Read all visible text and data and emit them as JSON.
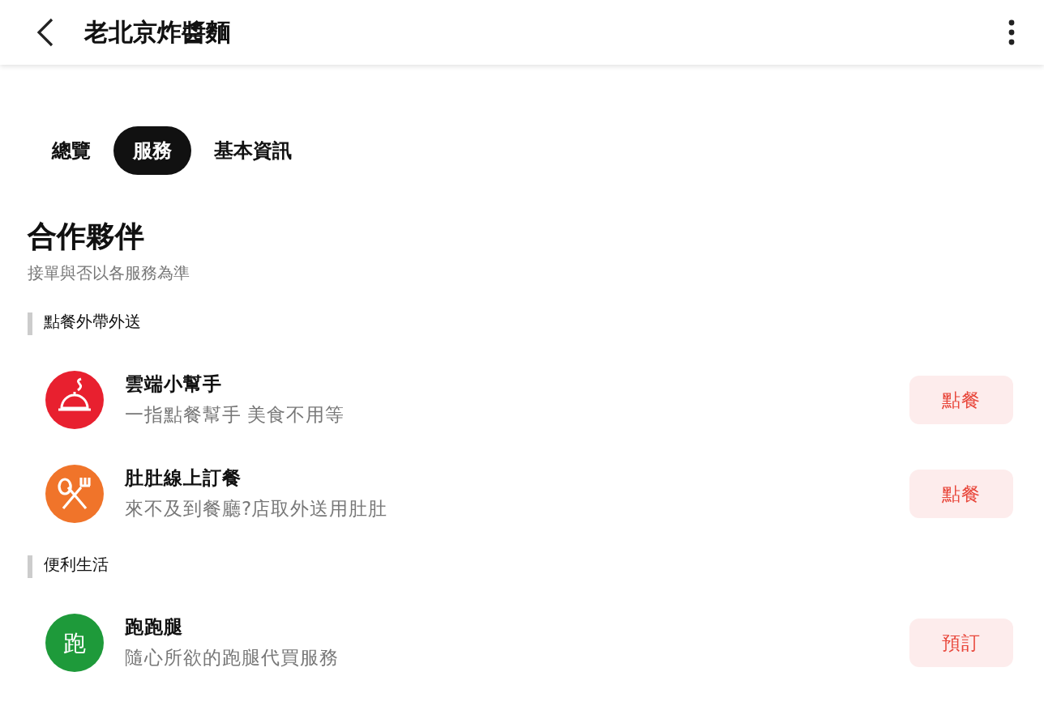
{
  "header": {
    "title": "老北京炸醬麵"
  },
  "tabs": [
    {
      "label": "總覽",
      "selected": false
    },
    {
      "label": "服務",
      "selected": true
    },
    {
      "label": "基本資訊",
      "selected": false
    }
  ],
  "section": {
    "title": "合作夥伴",
    "subtitle": "接單與否以各服務為準"
  },
  "groups": [
    {
      "label": "點餐外帶外送",
      "services": [
        {
          "name": "雲端小幫手",
          "description": "一指點餐幫手 美食不用等",
          "action": "點餐",
          "kind": "cloche",
          "color": "#e8202f"
        },
        {
          "name": "肚肚線上訂餐",
          "description": "來不及到餐廳?店取外送用肚肚",
          "action": "點餐",
          "kind": "utensils",
          "color": "#f0742a"
        }
      ]
    },
    {
      "label": "便利生活",
      "services": [
        {
          "name": "跑跑腿",
          "description": "隨心所欲的跑腿代買服務",
          "action": "預訂",
          "kind": "glyph",
          "glyph": "跑",
          "color": "#1e9a3a"
        }
      ]
    }
  ]
}
